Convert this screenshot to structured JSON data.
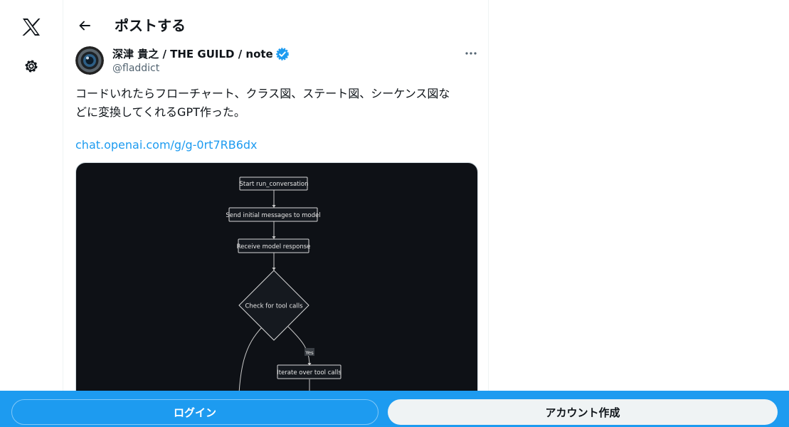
{
  "header": {
    "title": "ポストする"
  },
  "tweet": {
    "display_name": "深津 貴之 / THE GUILD / note",
    "handle": "@fladdict",
    "text_line1": "コードいれたらフローチャート、クラス図、ステート図、シーケンス図な",
    "text_line2": "どに変換してくれるGPT作った。",
    "link": "chat.openai.com/g/g-0rt7RB6dx"
  },
  "flowchart": {
    "nodes": {
      "start": "Start run_conversation",
      "send": "Send initial messages to model",
      "receive": "Receive model response",
      "check": "Check for tool calls",
      "yes": "Yes",
      "iterate": "Iterate over tool calls"
    }
  },
  "bottom": {
    "login": "ログイン",
    "signup": "アカウント作成"
  },
  "icons": {
    "logo": "x-logo-icon",
    "settings": "gear-icon",
    "back": "back-arrow-icon",
    "verified": "verified-badge-icon",
    "more": "more-dots-icon"
  },
  "colors": {
    "accent": "#1d9bf0",
    "text": "#0f1419",
    "secondary": "#536471",
    "media_bg": "#0e1116"
  }
}
